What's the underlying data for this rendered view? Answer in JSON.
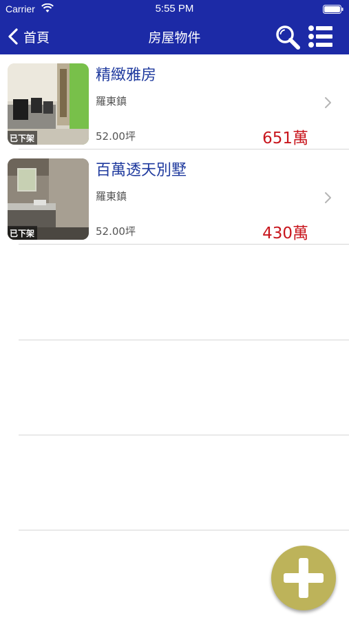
{
  "status_bar": {
    "carrier": "Carrier",
    "time": "5:55 PM"
  },
  "nav": {
    "back_label": "首頁",
    "title": "房屋物件",
    "icons": [
      "chevron-left-icon",
      "search-icon",
      "list-icon"
    ]
  },
  "listings": [
    {
      "title": "精緻雅房",
      "location": "羅東鎮",
      "area": "52.00坪",
      "price": "651萬",
      "badge": "已下架"
    },
    {
      "title": "百萬透天別墅",
      "location": "羅東鎮",
      "area": "52.00坪",
      "price": "430萬",
      "badge": "已下架"
    }
  ],
  "colors": {
    "nav_background": "#1c2aa6",
    "title_blue": "#1f3a9e",
    "price_red": "#c8161d",
    "fab_gold": "#bdb35a"
  },
  "fab": {
    "icon": "plus-icon"
  }
}
